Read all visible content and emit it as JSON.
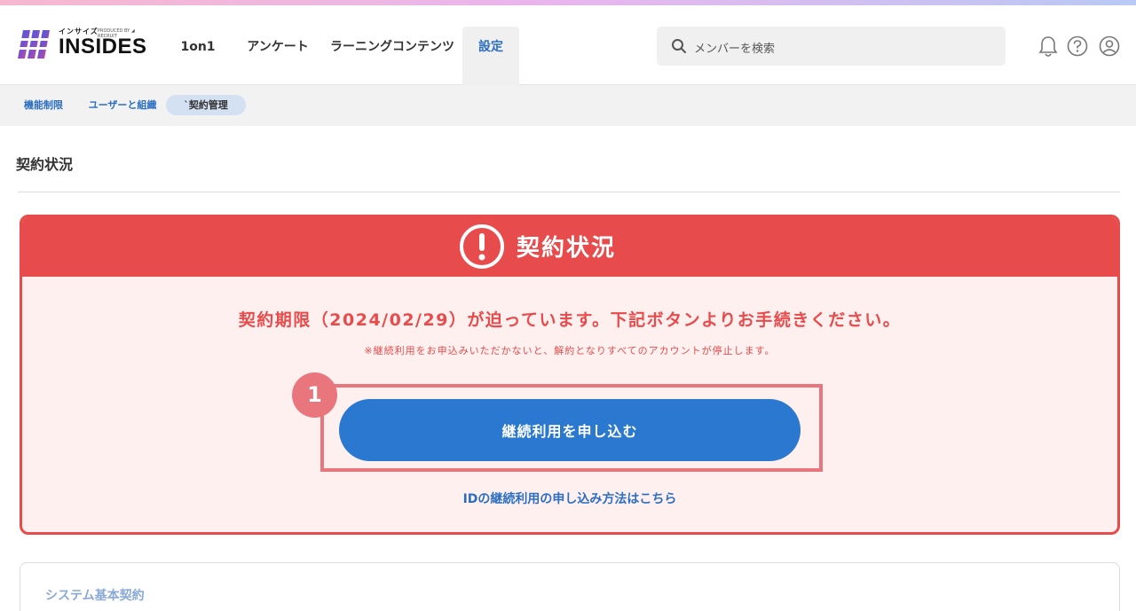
{
  "brand": {
    "logo_kana": "インサイズ",
    "logo_produced": "PRODUCED BY ◢ RECRUIT",
    "logo_text": "INSIDES"
  },
  "nav": {
    "items": [
      {
        "label": "1on1"
      },
      {
        "label": "アンケート"
      },
      {
        "label": "ラーニングコンテンツ"
      },
      {
        "label": "設定"
      }
    ]
  },
  "search": {
    "placeholder": "メンバーを検索"
  },
  "subnav": {
    "items": [
      {
        "label": "機能制限"
      },
      {
        "label": "ユーザーと組織"
      },
      {
        "label": "`契約管理"
      }
    ]
  },
  "page": {
    "title": "契約状況"
  },
  "alert": {
    "title": "契約状況",
    "message": "契約期限（2024/02/29）が迫っています。下記ボタンよりお手続きください。",
    "note": "※継続利用をお申込みいただかないと、解約となりすべてのアカウントが停止します。",
    "step_number": "1",
    "button_label": "継続利用を申し込む",
    "help_link": "IDの継続利用の申し込み方法はこちら",
    "color": "#e84b4b"
  },
  "system": {
    "title": "システム基本契約"
  },
  "colors": {
    "accent": "#2a78cf",
    "highlight": "#e8767c"
  }
}
